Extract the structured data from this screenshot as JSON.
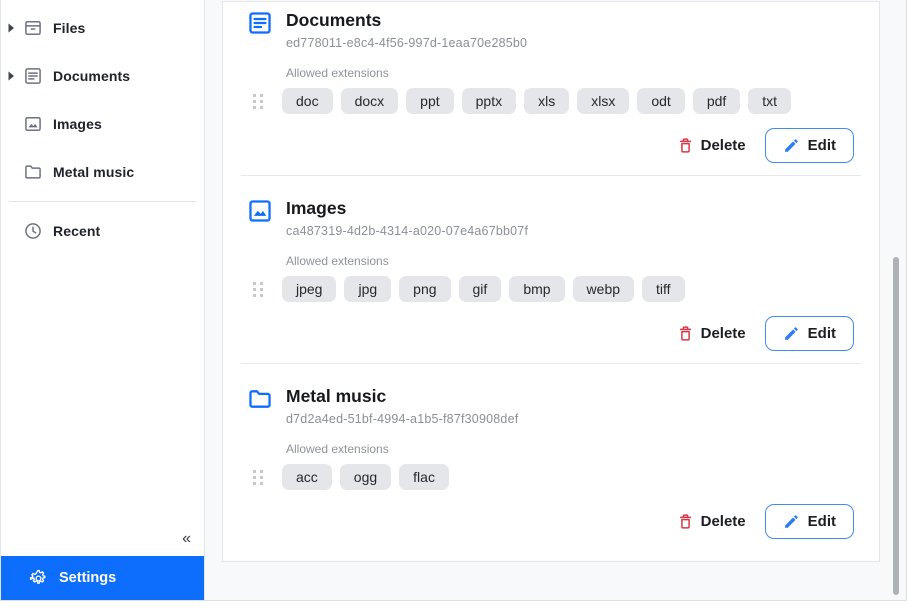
{
  "colors": {
    "accent": "#0d6efd",
    "danger": "#dc3545",
    "chip_bg": "#e5e6e9"
  },
  "sidebar": {
    "items": [
      {
        "label": "Files",
        "icon": "archive-box-icon",
        "expandable": true
      },
      {
        "label": "Documents",
        "icon": "document-icon",
        "expandable": true
      },
      {
        "label": "Images",
        "icon": "image-icon",
        "expandable": false
      },
      {
        "label": "Metal music",
        "icon": "folder-icon",
        "expandable": false
      }
    ],
    "recent_label": "Recent",
    "collapse_glyph": "«",
    "settings_label": "Settings"
  },
  "content": {
    "entries": [
      {
        "title": "Documents",
        "id": "ed778011-e8c4-4f56-997d-1eaa70e285b0",
        "icon": "document-icon",
        "extensions_label": "Allowed extensions",
        "extensions": [
          "doc",
          "docx",
          "ppt",
          "pptx",
          "xls",
          "xlsx",
          "odt",
          "pdf",
          "txt"
        ],
        "delete_label": "Delete",
        "edit_label": "Edit"
      },
      {
        "title": "Images",
        "id": "ca487319-4d2b-4314-a020-07e4a67bb07f",
        "icon": "image-icon",
        "extensions_label": "Allowed extensions",
        "extensions": [
          "jpeg",
          "jpg",
          "png",
          "gif",
          "bmp",
          "webp",
          "tiff"
        ],
        "delete_label": "Delete",
        "edit_label": "Edit"
      },
      {
        "title": "Metal music",
        "id": "d7d2a4ed-51bf-4994-a1b5-f87f30908def",
        "icon": "folder-icon",
        "extensions_label": "Allowed extensions",
        "extensions": [
          "acc",
          "ogg",
          "flac"
        ],
        "delete_label": "Delete",
        "edit_label": "Edit"
      }
    ]
  }
}
